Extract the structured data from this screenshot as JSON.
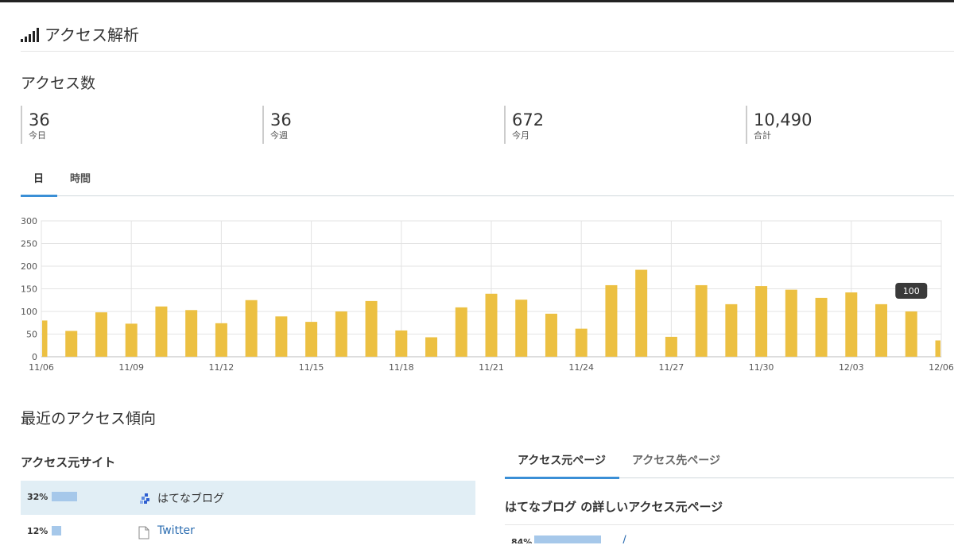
{
  "header": {
    "title": "アクセス解析",
    "icon": "signal-bars-icon"
  },
  "access_count": {
    "title": "アクセス数",
    "stats": [
      {
        "value": "36",
        "label": "今日"
      },
      {
        "value": "36",
        "label": "今週"
      },
      {
        "value": "672",
        "label": "今月"
      },
      {
        "value": "10,490",
        "label": "合計"
      }
    ]
  },
  "tabs": [
    {
      "label": "日",
      "active": true
    },
    {
      "label": "時間",
      "active": false
    }
  ],
  "chart_data": {
    "type": "bar",
    "categories": [
      "11/06",
      "11/07",
      "11/08",
      "11/09",
      "11/10",
      "11/11",
      "11/12",
      "11/13",
      "11/14",
      "11/15",
      "11/16",
      "11/17",
      "11/18",
      "11/19",
      "11/20",
      "11/21",
      "11/22",
      "11/23",
      "11/24",
      "11/25",
      "11/26",
      "11/27",
      "11/28",
      "11/29",
      "11/30",
      "12/01",
      "12/02",
      "12/03",
      "12/04",
      "12/05",
      "12/06"
    ],
    "values": [
      80,
      57,
      98,
      73,
      111,
      103,
      74,
      125,
      89,
      77,
      100,
      123,
      58,
      43,
      109,
      139,
      126,
      95,
      62,
      158,
      192,
      44,
      158,
      116,
      156,
      148,
      130,
      142,
      116,
      100,
      36
    ],
    "x_tick_labels": [
      "11/06",
      "11/09",
      "11/12",
      "11/15",
      "11/18",
      "11/21",
      "11/24",
      "11/27",
      "11/30",
      "12/03",
      "12/06"
    ],
    "y_ticks": [
      0,
      50,
      100,
      150,
      200,
      250,
      300
    ],
    "ylim": [
      0,
      300
    ],
    "grid": true,
    "tooltip": {
      "category": "12/05",
      "text": "100"
    },
    "bar_color": "#ecc042"
  },
  "recent": {
    "title": "最近のアクセス傾向",
    "sites_title": "アクセス元サイト",
    "sites": [
      {
        "pct": "32%",
        "share": 0.32,
        "name": "はてなブログ",
        "icon": "hatena-blog-icon",
        "link": false,
        "highlighted": true
      },
      {
        "pct": "12%",
        "share": 0.12,
        "name": "Twitter",
        "icon": "document-icon",
        "link": true,
        "highlighted": false
      }
    ]
  },
  "right_tabs": [
    {
      "label": "アクセス元ページ",
      "active": true
    },
    {
      "label": "アクセス先ページ",
      "active": false
    }
  ],
  "detail": {
    "title": "はてなブログ の詳しいアクセス元ページ",
    "rows": [
      {
        "pct": "84%",
        "share": 0.84,
        "link": "/"
      }
    ]
  },
  "colors": {
    "accent": "#3a8fd6",
    "bar": "#ecc042",
    "site_bar": "#a6c8ea",
    "highlight_row": "#e1eef5",
    "link": "#2b6cb0"
  }
}
